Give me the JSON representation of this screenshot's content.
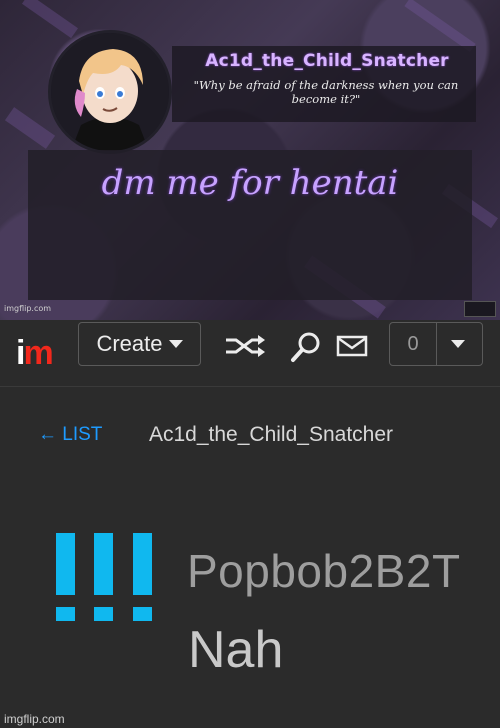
{
  "meme": {
    "username": "Ac1d_the_Child_Snatcher",
    "quote": "\"Why be afraid of the darkness when you can become it?\"",
    "message": "dm me for hentai",
    "watermark": "imgflip.com"
  },
  "navbar": {
    "logo_i": "i",
    "logo_m": "m",
    "create_label": "Create",
    "notification_count": "0",
    "icons": [
      "shuffle-icon",
      "search-icon",
      "mail-icon",
      "chevron-down-icon"
    ]
  },
  "page": {
    "back_link": "← LIST",
    "username": "Ac1d_the_Child_Snatcher"
  },
  "comment": {
    "icon": "exclamation-marks-icon",
    "username": "Popbob2B2T",
    "text": "Nah"
  },
  "footer": {
    "watermark": "imgflip.com"
  },
  "colors": {
    "logo_red": "#f2281c",
    "link_blue": "#1e9bff",
    "icon_cyan": "#10b8ef",
    "meme_purple": "#c7a2ff"
  }
}
